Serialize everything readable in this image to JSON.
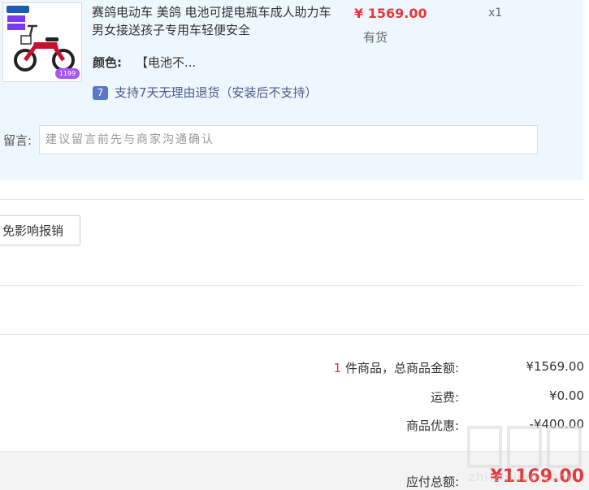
{
  "item": {
    "thumb_price": "1199",
    "title": "赛鸽电动车 美鸽 电池可提电瓶车成人助力车男女接送孩子专用车轻便安全",
    "price": "¥ 1569.00",
    "quantity": "x1",
    "stock": "有货",
    "color_label": "颜色:",
    "color_value": "【电池不...",
    "return_icon_char": "7",
    "return_policy": "支持7天无理由退货（安装后不支持）",
    "message_label": "留言:",
    "message_placeholder": "建议留言前先与商家沟通确认",
    "icon": "seven-day-return-icon"
  },
  "invoice": {
    "button_label": "免影响报销"
  },
  "summary": {
    "item_count": "1",
    "items_label": " 件商品，总商品金额:",
    "items_total": "¥1569.00",
    "shipping_label": "运费:",
    "shipping_value": "¥0.00",
    "discount_label": "商品优惠:",
    "discount_value": "-¥400.00",
    "payable_label": "应付总额:",
    "payable_value": "¥1169.00"
  },
  "watermark": {
    "site": "zhi.zhiliao.com"
  },
  "colors": {
    "price_red": "#e4393c",
    "panel_bg": "#eef7fd",
    "return_icon": "#5b78c8"
  }
}
